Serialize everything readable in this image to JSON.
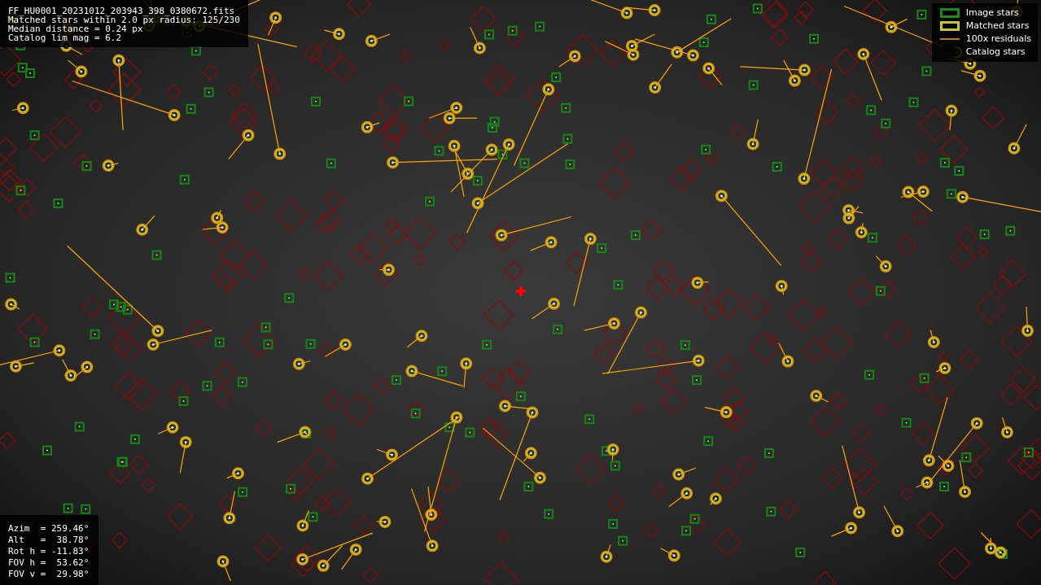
{
  "file_info": {
    "lines": [
      "FF_HU0001_20231012_203943_398_0380672.fits",
      "Matched stars within 2.0 px radius: 125/230",
      "Median distance = 0.24 px",
      "Catalog lim mag = 6.2"
    ]
  },
  "legend": {
    "items": [
      {
        "kind": "image",
        "label": "Image stars"
      },
      {
        "kind": "matched",
        "label": "Matched stars"
      },
      {
        "kind": "residual",
        "label": "100x residuals"
      },
      {
        "kind": "catalog",
        "label": "Catalog stars"
      }
    ]
  },
  "pointing": {
    "lines": [
      "Azim  = 259.46°",
      "Alt   =  38.78°",
      "Rot h = -11.83°",
      "FOV h =  53.62°",
      "FOV v =  29.98°"
    ]
  }
}
